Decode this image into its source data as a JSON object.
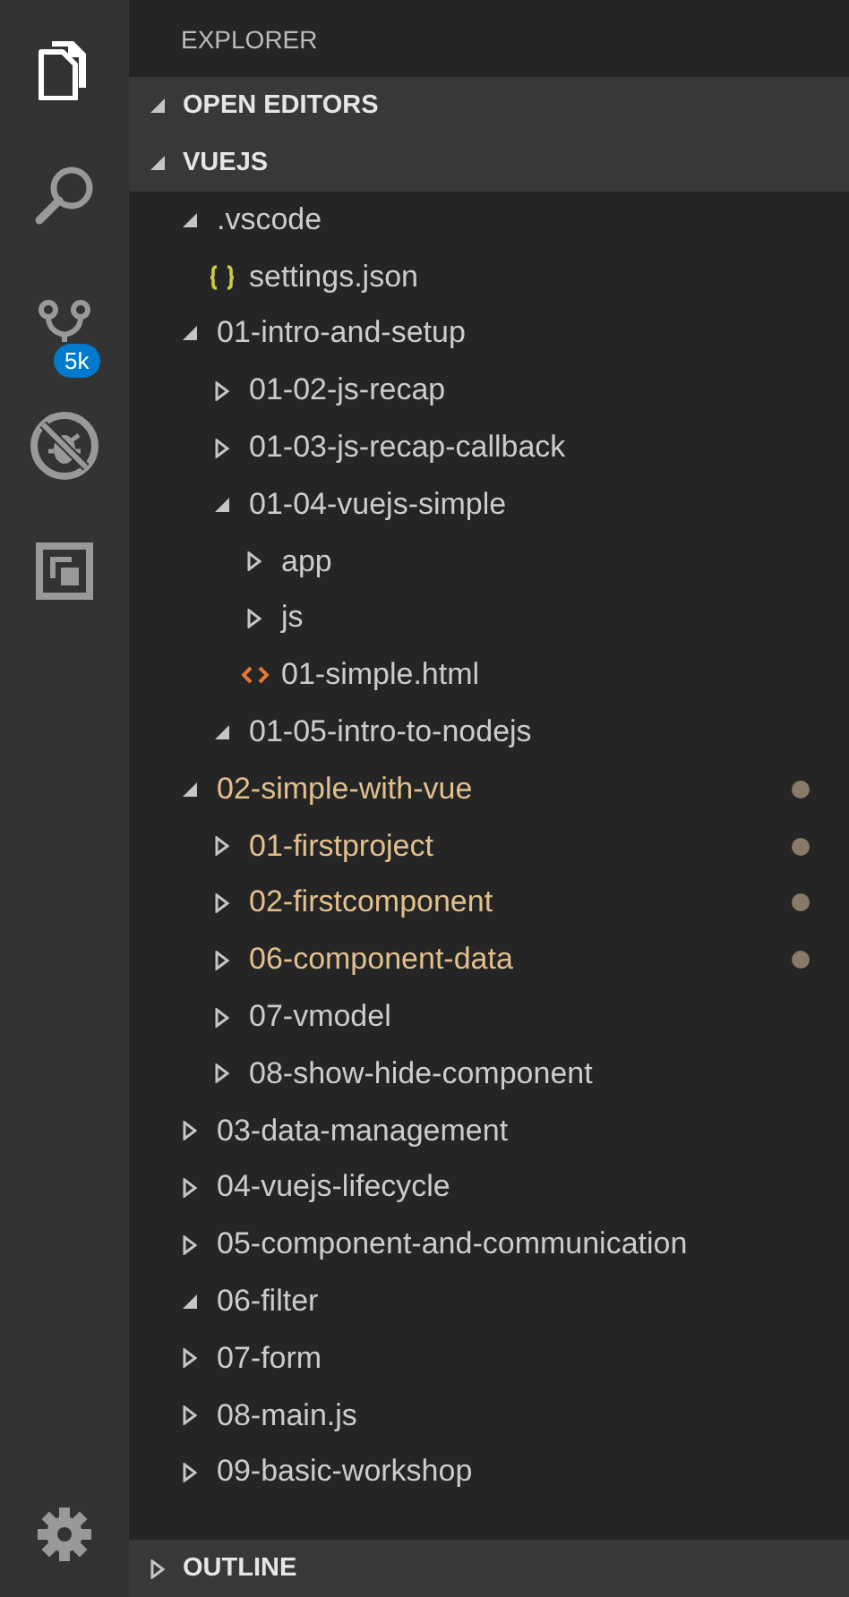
{
  "activity_bar": {
    "items": [
      {
        "kind": "files",
        "selected": true
      },
      {
        "kind": "search",
        "selected": false
      },
      {
        "kind": "source-control",
        "selected": false,
        "badge": "5k"
      },
      {
        "kind": "debug",
        "selected": false
      },
      {
        "kind": "extensions",
        "selected": false
      }
    ],
    "bottom": [
      {
        "kind": "settings",
        "selected": false
      }
    ]
  },
  "sidebar": {
    "title": "EXPLORER",
    "sections": [
      {
        "label": "OPEN EDITORS",
        "expanded": true
      },
      {
        "label": "VUEJS",
        "expanded": true
      }
    ],
    "tree": [
      {
        "label": ".vscode",
        "kind": "folder",
        "expanded": true,
        "modified": false,
        "children": [
          {
            "label": "settings.json",
            "kind": "json",
            "modified": false
          }
        ]
      },
      {
        "label": "01-intro-and-setup",
        "kind": "folder",
        "expanded": true,
        "modified": false,
        "children": [
          {
            "label": "01-02-js-recap",
            "kind": "folder",
            "expanded": false,
            "modified": false
          },
          {
            "label": "01-03-js-recap-callback",
            "kind": "folder",
            "expanded": false,
            "modified": false
          },
          {
            "label": "01-04-vuejs-simple",
            "kind": "folder",
            "expanded": true,
            "modified": false,
            "children": [
              {
                "label": "app",
                "kind": "folder",
                "expanded": false,
                "modified": false
              },
              {
                "label": "js",
                "kind": "folder",
                "expanded": false,
                "modified": false
              },
              {
                "label": "01-simple.html",
                "kind": "html",
                "modified": false
              }
            ]
          },
          {
            "label": "01-05-intro-to-nodejs",
            "kind": "folder",
            "expanded": true,
            "modified": false
          }
        ]
      },
      {
        "label": "02-simple-with-vue",
        "kind": "folder",
        "expanded": true,
        "modified": true,
        "children": [
          {
            "label": "01-firstproject",
            "kind": "folder",
            "expanded": false,
            "modified": true
          },
          {
            "label": "02-firstcomponent",
            "kind": "folder",
            "expanded": false,
            "modified": true
          },
          {
            "label": "06-component-data",
            "kind": "folder",
            "expanded": false,
            "modified": true
          },
          {
            "label": "07-vmodel",
            "kind": "folder",
            "expanded": false,
            "modified": false
          },
          {
            "label": "08-show-hide-component",
            "kind": "folder",
            "expanded": false,
            "modified": false
          }
        ]
      },
      {
        "label": "03-data-management",
        "kind": "folder",
        "expanded": false,
        "modified": false
      },
      {
        "label": "04-vuejs-lifecycle",
        "kind": "folder",
        "expanded": false,
        "modified": false
      },
      {
        "label": "05-component-and-communication",
        "kind": "folder",
        "expanded": false,
        "modified": false
      },
      {
        "label": "06-filter",
        "kind": "folder",
        "expanded": true,
        "modified": false
      },
      {
        "label": "07-form",
        "kind": "folder",
        "expanded": false,
        "modified": false
      },
      {
        "label": "08-main.js",
        "kind": "folder",
        "expanded": false,
        "modified": false
      },
      {
        "label": "09-basic-workshop",
        "kind": "folder",
        "expanded": false,
        "modified": false
      }
    ],
    "footer_sections": [
      {
        "label": "OUTLINE",
        "expanded": false
      }
    ]
  }
}
